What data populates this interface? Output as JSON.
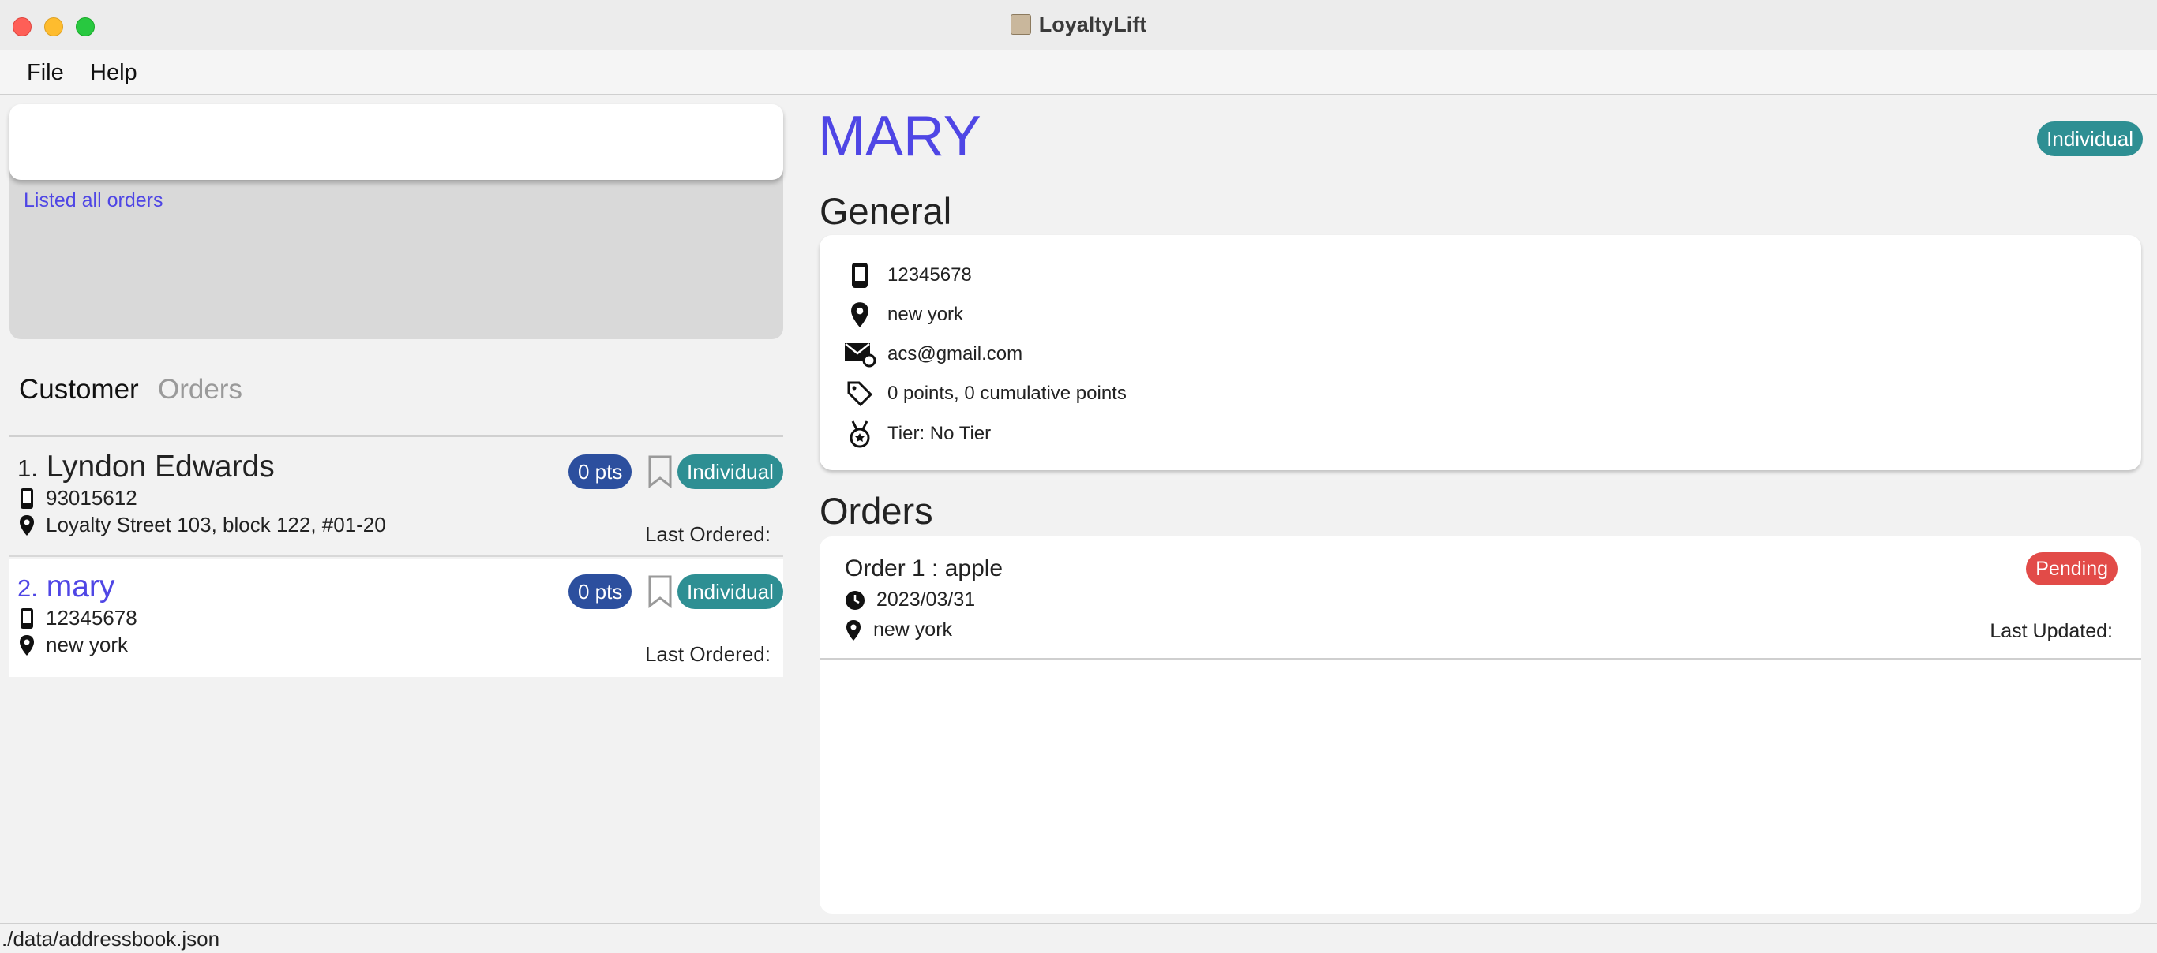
{
  "window": {
    "title": "LoyaltyLift"
  },
  "menu": {
    "file": "File",
    "help": "Help"
  },
  "command": {
    "value": "",
    "result": "Listed all orders"
  },
  "tabs": {
    "customer": "Customer",
    "orders": "Orders"
  },
  "customers": [
    {
      "index": "1.",
      "name": "Lyndon Edwards",
      "points": "0 pts",
      "type": "Individual",
      "phone": "93015612",
      "address": "Loyalty Street 103, block 122, #01-20",
      "last_ordered": "Last Ordered:"
    },
    {
      "index": "2.",
      "name": "mary",
      "points": "0 pts",
      "type": "Individual",
      "phone": "12345678",
      "address": "new york",
      "last_ordered": "Last Ordered:"
    }
  ],
  "detail": {
    "name": "MARY",
    "type": "Individual",
    "general_heading": "General",
    "phone": "12345678",
    "address": "new york",
    "email": "acs@gmail.com",
    "points": "0 points, 0 cumulative points",
    "tier": "Tier: No Tier",
    "orders_heading": "Orders",
    "orders": [
      {
        "title": "Order 1 : apple",
        "status": "Pending",
        "date": "2023/03/31",
        "address": "new york",
        "last_updated": "Last Updated:"
      }
    ]
  },
  "status": {
    "path": "./data/addressbook.json"
  },
  "colors": {
    "accent": "#4f46e5",
    "badge_points": "#2c4f9e",
    "badge_type": "#2e8f93",
    "badge_pending": "#e24b48"
  },
  "icons": [
    "phone-icon",
    "location-icon",
    "email-icon",
    "tag-icon",
    "medal-icon",
    "clock-icon",
    "bookmark-icon"
  ]
}
